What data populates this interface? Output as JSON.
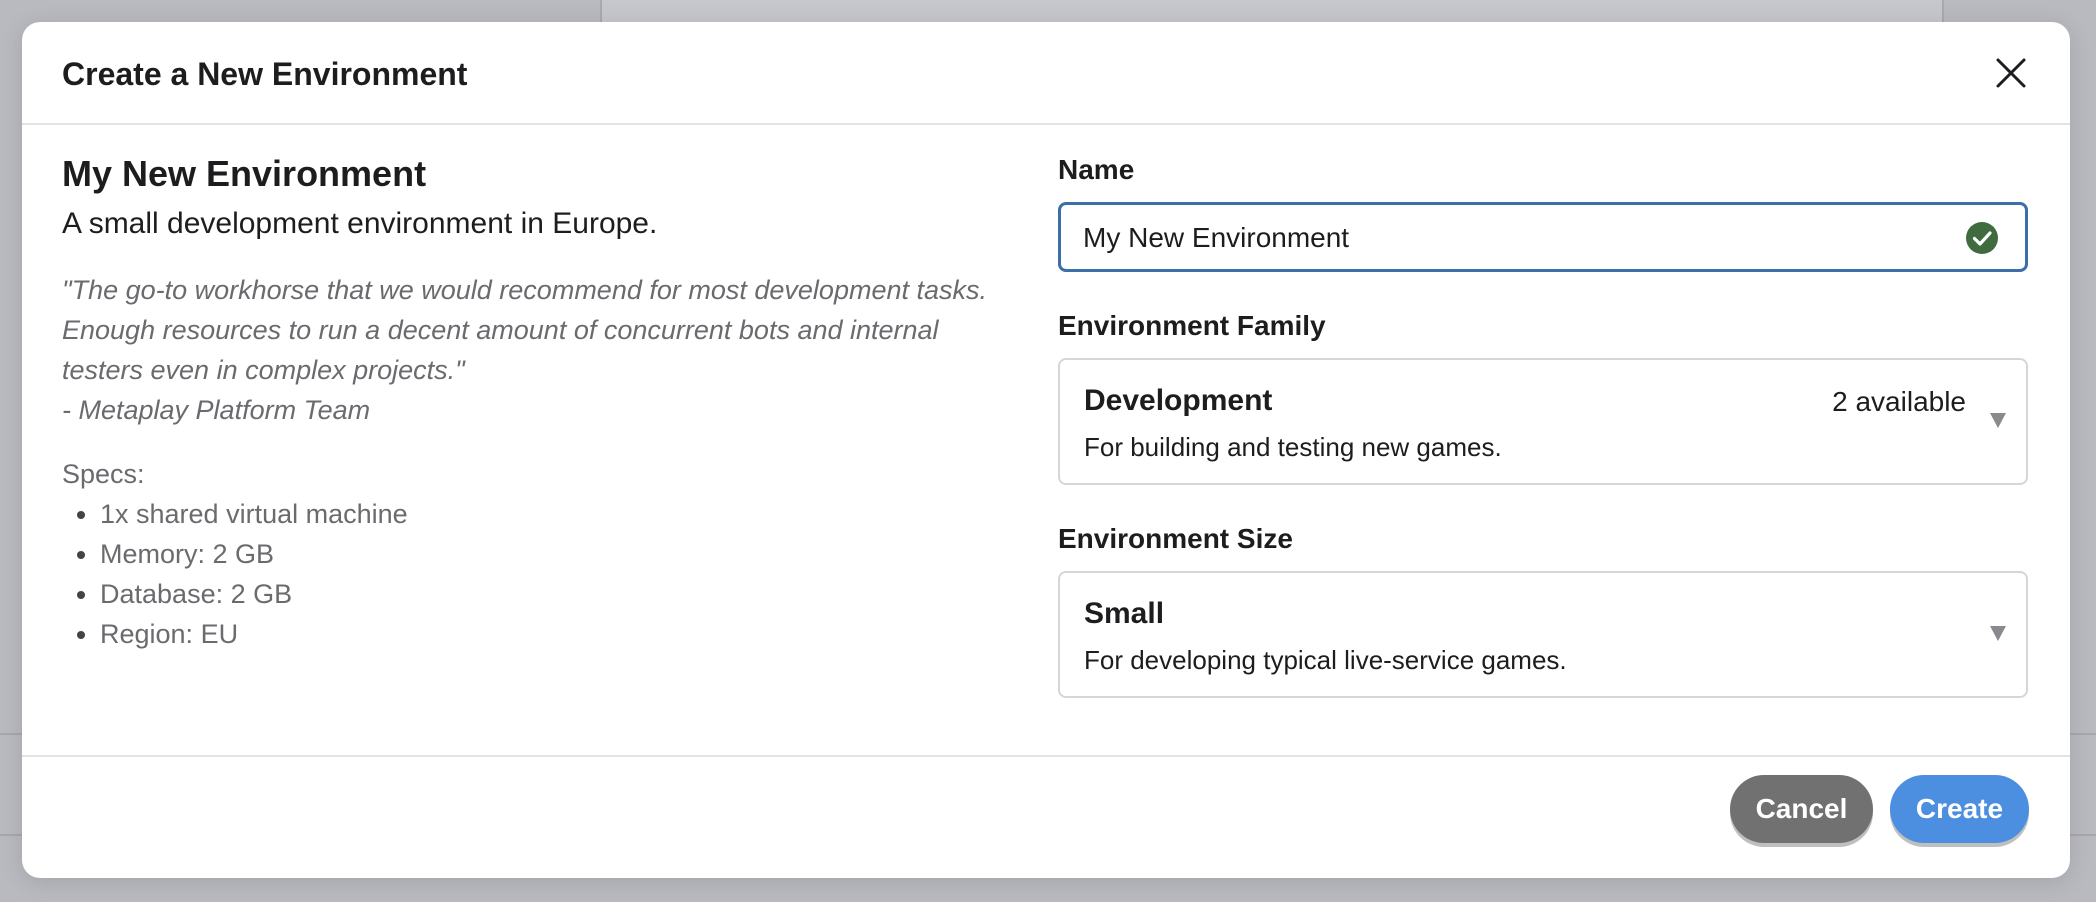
{
  "modal": {
    "title": "Create a New Environment"
  },
  "summary": {
    "title": "My New Environment",
    "description": "A small development environment in Europe.",
    "quote": "\"The go-to workhorse that we would recommend for most development tasks. Enough resources to run a decent amount of concurrent bots and internal testers even in complex projects.\"",
    "quote_author": "- Metaplay Platform Team",
    "specs_label": "Specs:",
    "specs": [
      "1x shared virtual machine",
      "Memory: 2 GB",
      "Database: 2 GB",
      "Region: EU"
    ]
  },
  "form": {
    "name_label": "Name",
    "name_value": "My New Environment",
    "name_valid": true,
    "family_label": "Environment Family",
    "family": {
      "title": "Development",
      "description": "For building and testing new games.",
      "badge": "2 available"
    },
    "size_label": "Environment Size",
    "size": {
      "title": "Small",
      "description": "For developing typical live-service games."
    }
  },
  "footer": {
    "cancel_label": "Cancel",
    "create_label": "Create"
  },
  "colors": {
    "accent": "#4c8fe0",
    "input_focus": "#3c6ea8",
    "valid": "#3f6b3f",
    "cancel": "#717171"
  },
  "icons": {
    "close": "close-icon",
    "valid": "check-circle-icon",
    "caret": "caret-down-icon"
  }
}
